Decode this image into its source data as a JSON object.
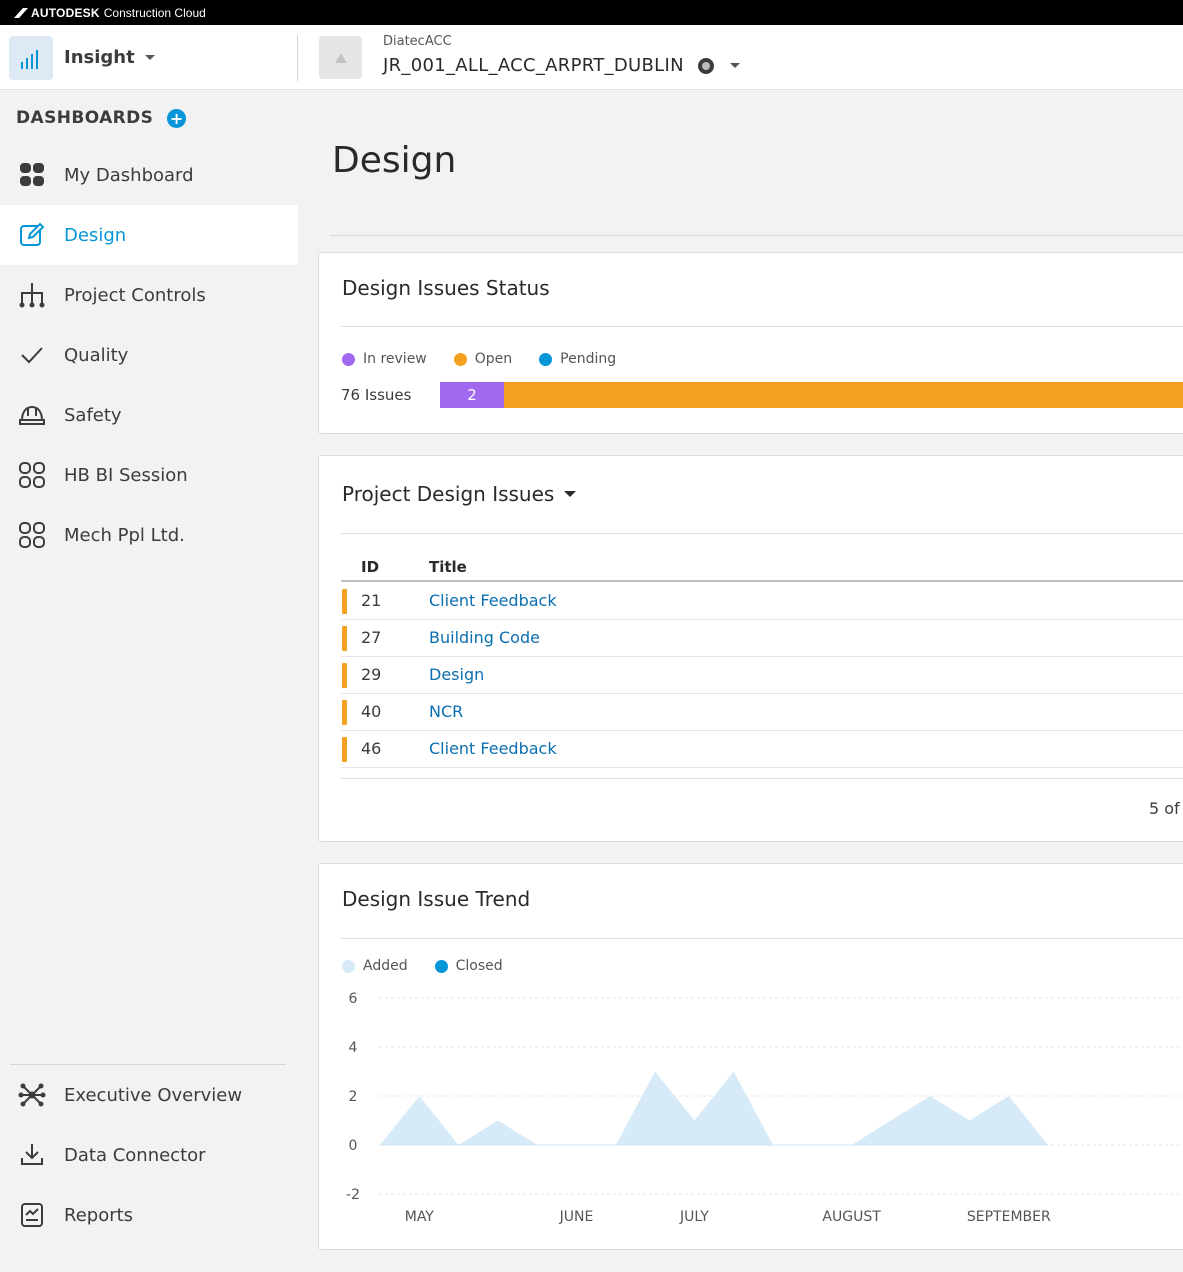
{
  "topbar": {
    "brand": "AUTODESK",
    "product": "Construction Cloud"
  },
  "header": {
    "app_name": "Insight",
    "account": "DiatecACC",
    "project": "JR_001_ALL_ACC_ARPRT_DUBLIN"
  },
  "sidebar": {
    "heading": "DASHBOARDS",
    "items": [
      {
        "label": "My Dashboard",
        "icon": "dashboard-grid-icon"
      },
      {
        "label": "Design",
        "icon": "edit-icon",
        "active": true
      },
      {
        "label": "Project Controls",
        "icon": "hierarchy-icon"
      },
      {
        "label": "Quality",
        "icon": "checkmark-icon"
      },
      {
        "label": "Safety",
        "icon": "hardhat-icon"
      },
      {
        "label": "HB BI Session",
        "icon": "grid-outline-icon"
      },
      {
        "label": "Mech Ppl Ltd.",
        "icon": "grid-outline-icon"
      }
    ],
    "bottom_items": [
      {
        "label": "Executive Overview",
        "icon": "network-icon"
      },
      {
        "label": "Data Connector",
        "icon": "download-icon"
      },
      {
        "label": "Reports",
        "icon": "report-icon"
      }
    ]
  },
  "page": {
    "title": "Design"
  },
  "status_card": {
    "title": "Design Issues Status",
    "legend": [
      {
        "label": "In review",
        "color": "#a169ef"
      },
      {
        "label": "Open",
        "color": "#f5a020"
      },
      {
        "label": "Pending",
        "color": "#0696d7"
      }
    ],
    "count_text": "76 Issues",
    "in_review_value": "2"
  },
  "issues_card": {
    "title": "Project Design Issues",
    "columns": {
      "id": "ID",
      "title": "Title"
    },
    "rows": [
      {
        "id": "21",
        "title": "Client Feedback"
      },
      {
        "id": "27",
        "title": "Building Code"
      },
      {
        "id": "29",
        "title": "Design"
      },
      {
        "id": "40",
        "title": "NCR"
      },
      {
        "id": "46",
        "title": "Client Feedback"
      }
    ],
    "pager": "5 of"
  },
  "trend_card": {
    "title": "Design Issue Trend",
    "legend": [
      {
        "label": "Added",
        "color": "#d6eaf8"
      },
      {
        "label": "Closed",
        "color": "#0696d7"
      }
    ]
  },
  "chart_data": {
    "type": "area",
    "title": "Design Issue Trend",
    "x": [
      "",
      "MAY",
      "",
      "",
      "",
      "JUNE",
      "",
      "",
      "JULY",
      "",
      "",
      "",
      "AUGUST",
      "",
      "",
      "",
      "SEPTEMBER",
      ""
    ],
    "x_ticks": [
      "MAY",
      "JUNE",
      "JULY",
      "AUGUST",
      "SEPTEMBER"
    ],
    "series": [
      {
        "name": "Added",
        "values": [
          0,
          2,
          0,
          1,
          0,
          0,
          0,
          3,
          1,
          3,
          0,
          0,
          0,
          1,
          2,
          1,
          2,
          0
        ]
      },
      {
        "name": "Closed",
        "values": [
          0,
          0,
          0,
          0,
          0,
          0,
          0,
          0,
          0,
          0,
          0,
          0,
          0,
          0,
          0,
          0,
          0,
          0
        ]
      }
    ],
    "y_ticks": [
      6,
      4,
      2,
      0,
      -2
    ],
    "ylim": [
      -2,
      6
    ],
    "grid": true,
    "legend_position": "top-left"
  }
}
